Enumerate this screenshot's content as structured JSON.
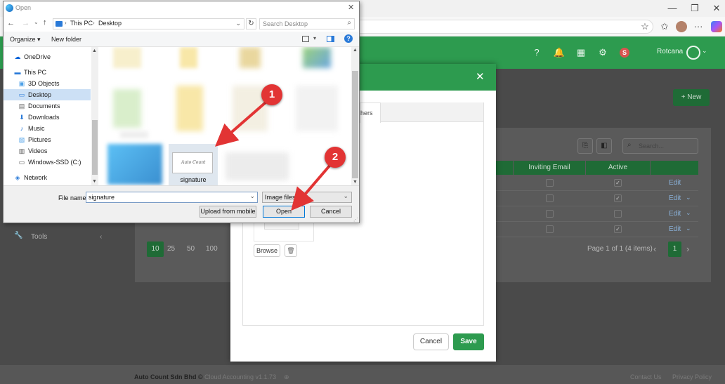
{
  "browser": {
    "minimize": "—",
    "restore": "❐",
    "close": "✕",
    "more": "···"
  },
  "app": {
    "user_name": "Rotcana",
    "new_button": "+ New",
    "search_placeholder": "Search...",
    "sidebar_tools": "Tools",
    "page_sizes": [
      "10",
      "25",
      "50",
      "100"
    ],
    "pagination_text": "Page 1 of 1 (4 items)",
    "current_page": "1",
    "table_headers": {
      "inviting_email": "Inviting Email",
      "active": "Active"
    },
    "rows": [
      {
        "active": true,
        "edit": "Edit",
        "has_dropdown": false
      },
      {
        "active": true,
        "edit": "Edit",
        "has_dropdown": true
      },
      {
        "active": false,
        "edit": "Edit",
        "has_dropdown": true
      },
      {
        "active": true,
        "edit": "Edit",
        "has_dropdown": true
      }
    ],
    "footer": {
      "company": "Auto Count Sdn Bhd ©",
      "product": "Cloud Accounting v1.1.73",
      "contact": "Contact Us",
      "privacy": "Privacy Policy"
    },
    "colors": {
      "brand_green": "#2d9b4f",
      "dim_overlay": "#4a4a4a"
    }
  },
  "modal": {
    "tab_partial": "hers",
    "browse_button": "Browse",
    "cancel_button": "Cancel",
    "save_button": "Save",
    "close_icon": "✕"
  },
  "file_dialog": {
    "title": "Open",
    "path": [
      "This PC",
      "Desktop"
    ],
    "search_placeholder": "Search Desktop",
    "organize": "Organize ▾",
    "new_folder": "New folder",
    "tree": [
      {
        "label": "OneDrive",
        "icon": "cloud-icon",
        "indent": 1
      },
      {
        "label": "This PC",
        "icon": "pc-icon",
        "indent": 1
      },
      {
        "label": "3D Objects",
        "icon": "cube-icon",
        "indent": 2
      },
      {
        "label": "Desktop",
        "icon": "desktop-icon",
        "indent": 2,
        "selected": true
      },
      {
        "label": "Documents",
        "icon": "document-icon",
        "indent": 2
      },
      {
        "label": "Downloads",
        "icon": "download-icon",
        "indent": 2
      },
      {
        "label": "Music",
        "icon": "music-icon",
        "indent": 2
      },
      {
        "label": "Pictures",
        "icon": "picture-icon",
        "indent": 2
      },
      {
        "label": "Videos",
        "icon": "video-icon",
        "indent": 2
      },
      {
        "label": "Windows-SSD (C:)",
        "icon": "drive-icon",
        "indent": 2
      },
      {
        "label": "Network",
        "icon": "network-icon",
        "indent": 1
      }
    ],
    "selected_file_label": "signature",
    "signature_preview_text": "Auto Count",
    "file_name_label": "File name:",
    "file_name_value": "signature",
    "file_type": "Image files",
    "upload_mobile": "Upload from mobile",
    "open_button": "Open",
    "cancel_button": "Cancel"
  },
  "annotations": [
    {
      "label": "1"
    },
    {
      "label": "2"
    }
  ]
}
